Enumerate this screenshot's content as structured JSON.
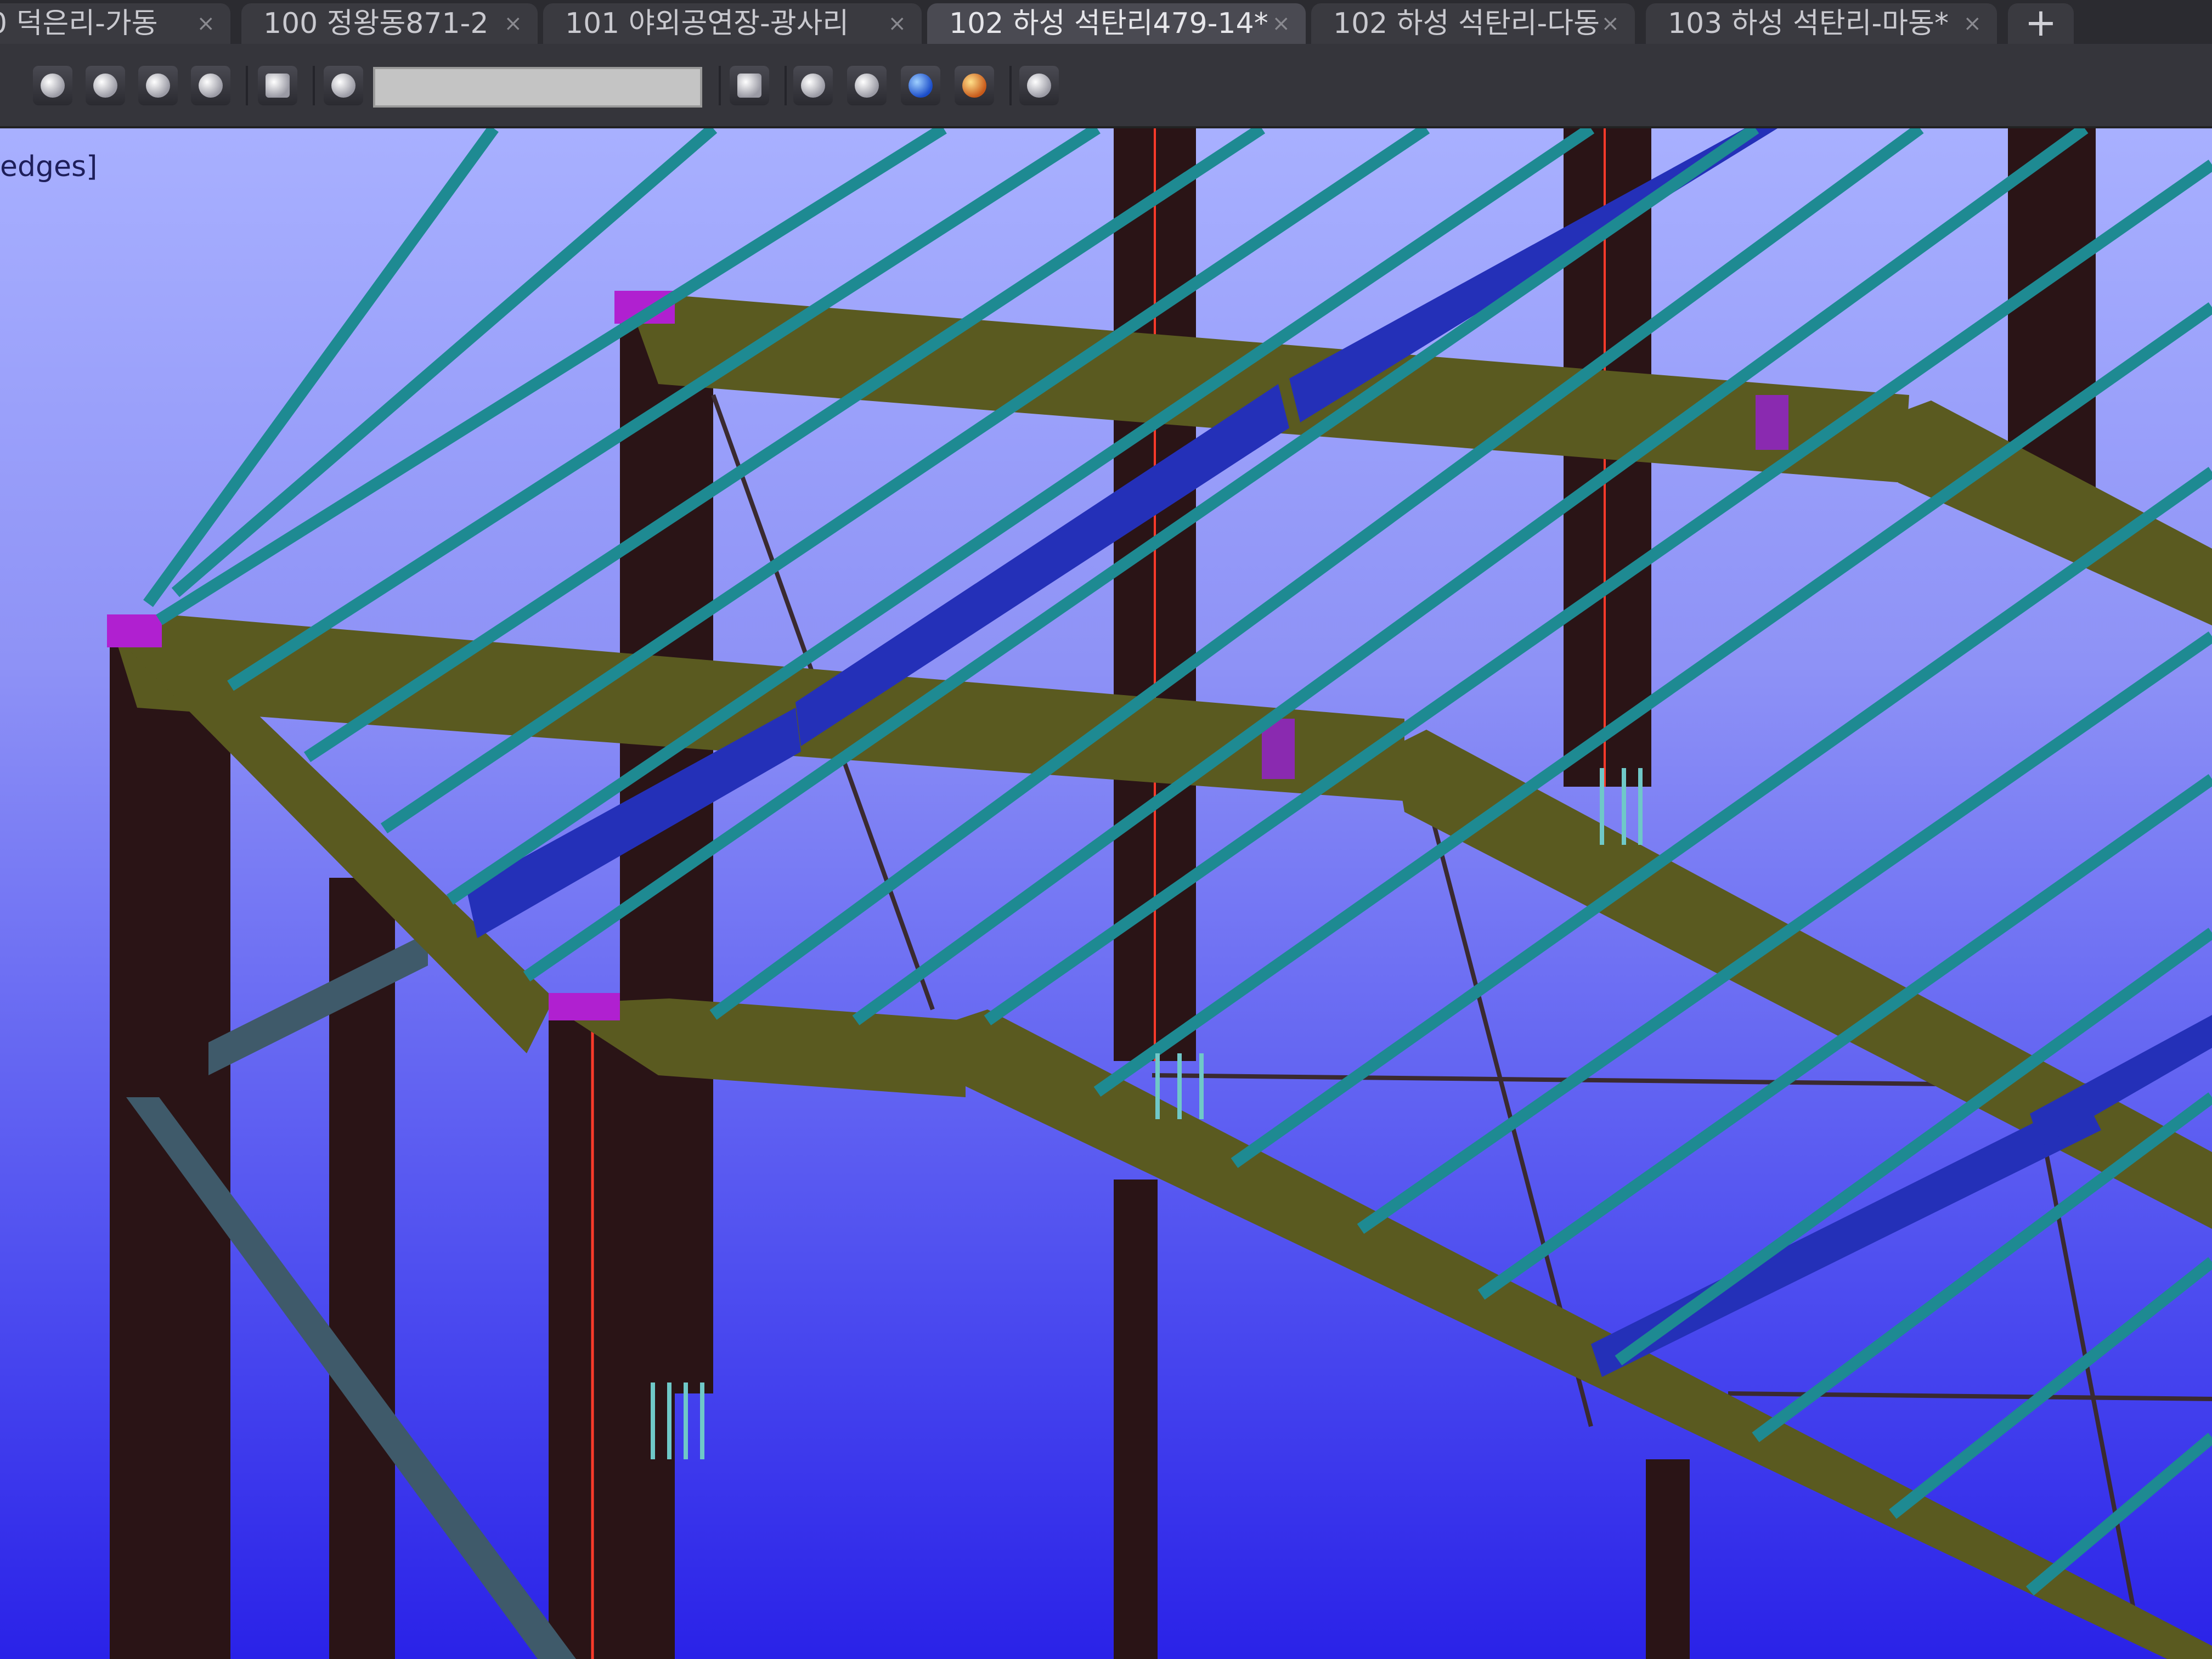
{
  "tabs": [
    {
      "label": "0 덕은리-가동",
      "active": false
    },
    {
      "label": "100 정왕동871-2",
      "active": false
    },
    {
      "label": "101 야외공연장-광사리",
      "active": false
    },
    {
      "label": "102 하성 석탄리479-14*",
      "active": true
    },
    {
      "label": "102 하성 석탄리-다동",
      "active": false
    },
    {
      "label": "103 하성 석탄리-마동*",
      "active": false
    }
  ],
  "new_tab_label": "+",
  "tab_close_glyph": "×",
  "toolbar": {
    "search_value": "",
    "icons": [
      "view-front-icon",
      "view-side-icon",
      "view-top-icon",
      "view-iso-icon",
      "camera-icon",
      "filter-icon",
      "refresh-view-icon",
      "render-white-icon",
      "render-white2-icon",
      "render-blue-icon",
      "render-gold-icon",
      "layer-icon"
    ]
  },
  "viewport": {
    "mode_label": "edges]",
    "colors": {
      "background_top": "#a8b0ff",
      "background_bottom": "#2a22e8",
      "column": "#2a1416",
      "beam": "#5a5a20",
      "purlin": "#1e8a92",
      "brace_blue": "#2430b8",
      "connection": "#b020d0",
      "red_line": "#ff3a2a"
    }
  }
}
